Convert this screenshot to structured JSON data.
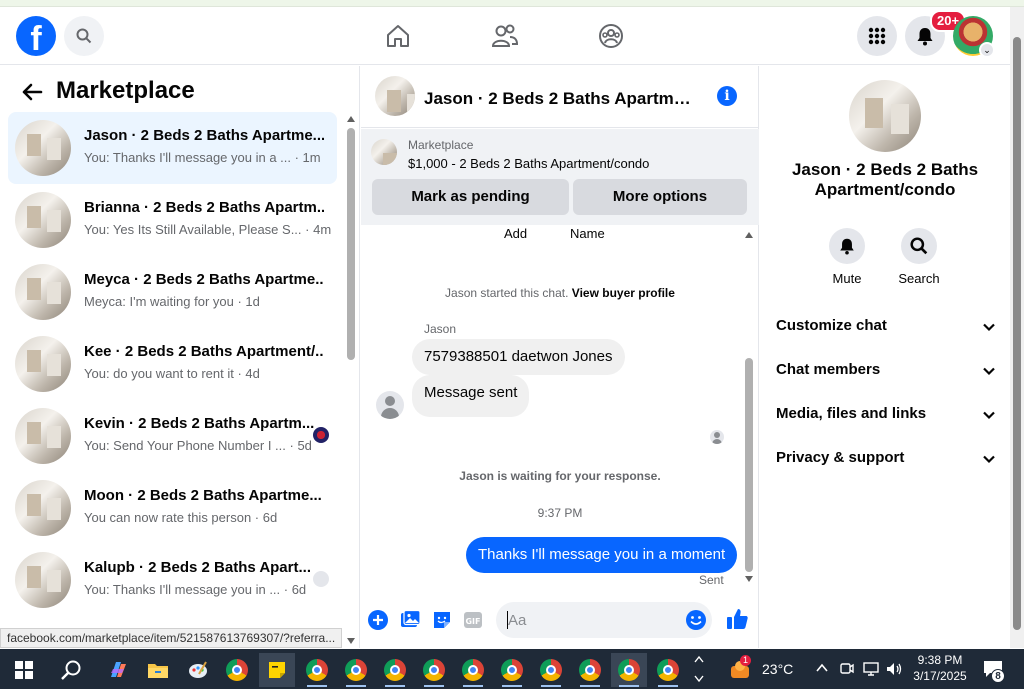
{
  "header": {
    "notification_badge": "20+"
  },
  "left_panel": {
    "title": "Marketplace",
    "conversations": [
      {
        "name": "Jason · 2 Beds 2 Baths Apartme...",
        "preview": "You: Thanks I'll message you in a ... · 1m",
        "active": true
      },
      {
        "name": "Brianna · 2 Beds 2 Baths Apartm...",
        "preview": "You: Yes Its Still Available, Please S... · 4m"
      },
      {
        "name": "Meyca · 2 Beds 2 Baths Apartme...",
        "preview": "Meyca: I'm waiting for you · 1d"
      },
      {
        "name": "Kee · 2 Beds 2 Baths Apartment/...",
        "preview": "You: do you want to rent it · 4d"
      },
      {
        "name": "Kevin · 2 Beds 2 Baths Apartm...",
        "preview": "You: Send Your Phone Number I ... · 5d"
      },
      {
        "name": "Moon · 2 Beds 2 Baths Apartme...",
        "preview": "You can now rate this person · 6d"
      },
      {
        "name": "Kalupb · 2 Beds 2 Baths Apart...",
        "preview": "You: Thanks I'll message you in ... · 6d"
      }
    ]
  },
  "status_url": "facebook.com/marketplace/item/521587613769307/?referra...",
  "chat": {
    "title": "Jason · 2 Beds 2 Baths Apartment/condo",
    "marketplace_label": "Marketplace",
    "listing": "$1,000 - 2 Beds 2 Baths Apartment/condo",
    "mark_pending": "Mark as pending",
    "more_options": "More options",
    "add_label": "Add",
    "name_label": "Name",
    "started_text": "Jason started this chat.",
    "view_profile": "View buyer profile",
    "sender": "Jason",
    "messages_in": [
      "7579388501 daetwon Jones",
      "Message sent"
    ],
    "waiting_text": "Jason is waiting for your response.",
    "timestamp": "9:37 PM",
    "message_out": "Thanks I'll message you in a moment",
    "sent_label": "Sent",
    "composer_placeholder": "Aa"
  },
  "info_panel": {
    "name_line1": "Jason · 2 Beds 2 Baths",
    "name_line2": "Apartment/condo",
    "mute": "Mute",
    "search": "Search",
    "sections": [
      "Customize chat",
      "Chat members",
      "Media, files and links",
      "Privacy & support"
    ]
  },
  "taskbar": {
    "temperature": "23°C",
    "time": "9:38 PM",
    "date": "3/17/2025",
    "weather_badge": "1",
    "notification_count": "8"
  },
  "colors": {
    "brand": "#0866ff",
    "active_conversation": "#ebf5ff",
    "badge": "#e41e3f",
    "taskbar": "#1f2a38"
  }
}
